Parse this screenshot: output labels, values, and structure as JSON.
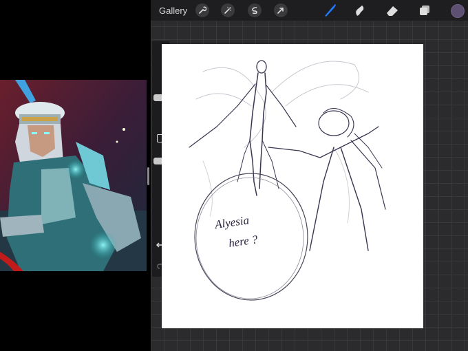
{
  "toolbar": {
    "gallery_label": "Gallery",
    "icons": [
      "wrench-icon",
      "magic-wand-icon",
      "selection-icon",
      "transform-arrow-icon",
      "brush-icon",
      "smudge-icon",
      "eraser-icon",
      "layers-icon"
    ],
    "active_tool": "brush",
    "current_color": "#5d5073"
  },
  "sidebar": {
    "controls": [
      "brush-size-slider",
      "modify-button",
      "opacity-slider",
      "undo-icon",
      "redo-icon"
    ]
  },
  "canvas": {
    "handwritten_note_line1": "Alyesia",
    "handwritten_note_line2": "here ?"
  },
  "colors": {
    "accent_blue": "#1f7bff",
    "sketch_stroke": "#3b3450"
  }
}
